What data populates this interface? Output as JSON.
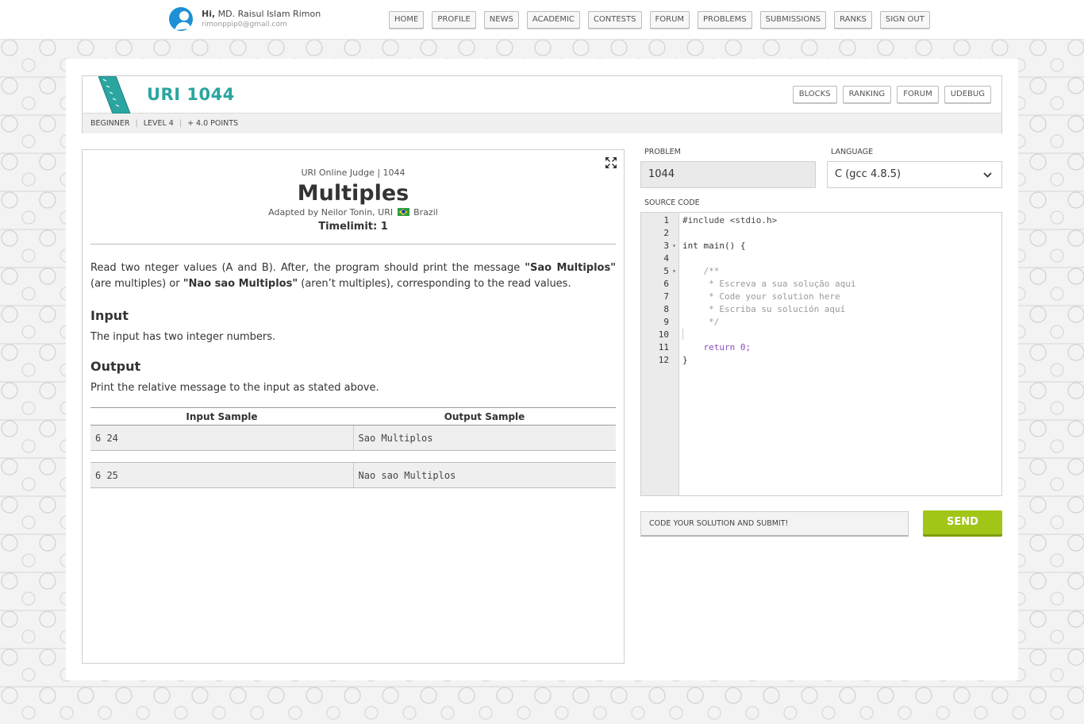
{
  "user": {
    "greeting": "Hi,",
    "name": "MD. Raisul Islam Rimon",
    "email": "rimonppip0@gmail.com"
  },
  "nav": {
    "items": [
      "HOME",
      "PROFILE",
      "NEWS",
      "ACADEMIC",
      "CONTESTS",
      "FORUM",
      "PROBLEMS",
      "SUBMISSIONS",
      "RANKS",
      "SIGN OUT"
    ]
  },
  "header": {
    "title": "URI 1044",
    "links": [
      "BLOCKS",
      "RANKING",
      "FORUM",
      "UDEBUG"
    ],
    "meta": [
      "BEGINNER",
      "LEVEL 4",
      "+ 4.0 POINTS"
    ],
    "accent_color": "#2aa5a0"
  },
  "statement": {
    "source": "URI Online Judge | 1044",
    "title": "Multiples",
    "author_prefix": "Adapted by Neilor Tonin, URI",
    "author_country": "Brazil",
    "timelimit": "Timelimit: 1",
    "desc_1": "Read two nteger values (A and B). After, the program should print the message ",
    "desc_b1": "\"Sao Multiplos\"",
    "desc_2": " (are multiples) or ",
    "desc_b2": "\"Nao sao Multiplos\"",
    "desc_3": " (aren’t multiples), corresponding to the read values.",
    "input_heading": "Input",
    "input_text": "The input has two integer numbers.",
    "output_heading": "Output",
    "output_text": "Print the relative message to the input as stated above.",
    "samples": {
      "input_header": "Input Sample",
      "output_header": "Output Sample",
      "rows": [
        {
          "input": "6 24",
          "output": "Sao Multiplos"
        },
        {
          "input": "6 25",
          "output": "Nao sao Multiplos"
        }
      ]
    }
  },
  "editor": {
    "problem_label": "PROBLEM",
    "problem_value": "1044",
    "language_label": "LANGUAGE",
    "language_value": "C (gcc 4.8.5)",
    "source_label": "SOURCE CODE",
    "code_lines": [
      {
        "n": "1",
        "text": "#include <stdio.h>"
      },
      {
        "n": "2",
        "text": ""
      },
      {
        "n": "3",
        "text": "int main() {"
      },
      {
        "n": "4",
        "text": ""
      },
      {
        "n": "5",
        "text": "    /**"
      },
      {
        "n": "6",
        "text": "     * Escreva a sua solução aqui"
      },
      {
        "n": "7",
        "text": "     * Code your solution here"
      },
      {
        "n": "8",
        "text": "     * Escriba su solución aquí"
      },
      {
        "n": "9",
        "text": "     */"
      },
      {
        "n": "10",
        "text": ""
      },
      {
        "n": "11",
        "text": "    return 0;"
      },
      {
        "n": "12",
        "text": "}"
      }
    ],
    "submit_message": "CODE YOUR SOLUTION AND SUBMIT!",
    "send_label": "SEND",
    "send_color": "#a2c617"
  }
}
